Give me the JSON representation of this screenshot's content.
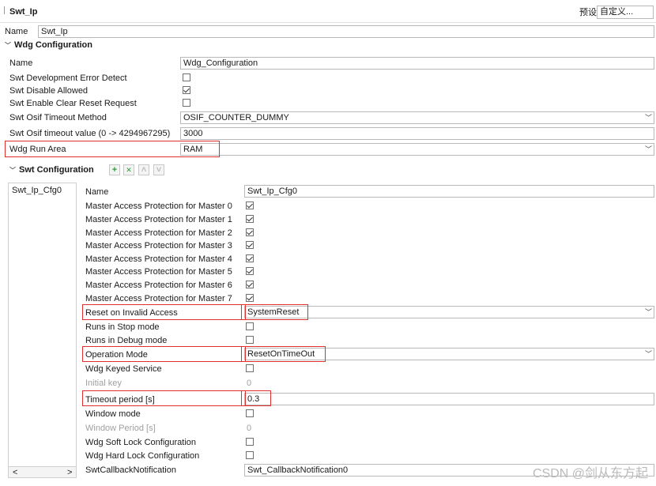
{
  "header": {
    "title": "Swt_Ip",
    "preset_label": "预设",
    "preset_value": "自定义..."
  },
  "top_name": {
    "label": "Name",
    "value": "Swt_Ip"
  },
  "wdg_config": {
    "title": "Wdg Configuration",
    "name_label": "Name",
    "name_value": "Wdg_Configuration",
    "dev_error_label": "Swt Development Error Detect",
    "disable_allowed_label": "Swt Disable Allowed",
    "clear_reset_label": "Swt Enable Clear Reset Request",
    "osif_method_label": "Swt Osif Timeout Method",
    "osif_method_value": "OSIF_COUNTER_DUMMY",
    "osif_timeout_label": "Swt Osif timeout value (0 -> 4294967295)",
    "osif_timeout_value": "3000",
    "run_area_label": "Wdg Run Area",
    "run_area_value": "RAM"
  },
  "swt_config": {
    "title": "Swt Configuration",
    "toolbar": {
      "add": "+",
      "remove": "✕",
      "up": "˄",
      "down": "˅"
    },
    "list_items": [
      "Swt_Ip_Cfg0"
    ],
    "name_label": "Name",
    "name_value": "Swt_Ip_Cfg0",
    "masters": [
      "Master Access Protection for Master 0",
      "Master Access Protection for Master 1",
      "Master Access Protection for Master 2",
      "Master Access Protection for Master 3",
      "Master Access Protection for Master 4",
      "Master Access Protection for Master 5",
      "Master Access Protection for Master 6",
      "Master Access Protection for Master 7"
    ],
    "reset_label": "Reset on Invalid Access",
    "reset_value": "SystemReset",
    "stop_label": "Runs in Stop mode",
    "debug_label": "Runs in Debug mode",
    "opmode_label": "Operation Mode",
    "opmode_value": "ResetOnTimeOut",
    "keyed_label": "Wdg Keyed Service",
    "initial_key_label": "Initial key",
    "initial_key_value": "0",
    "timeout_label": "Timeout period [s]",
    "timeout_value": "0.3",
    "window_label": "Window mode",
    "window_period_label": "Window Period [s]",
    "window_period_value": "0",
    "soft_lock_label": "Wdg Soft Lock Configuration",
    "hard_lock_label": "Wdg Hard Lock Configuration",
    "callback_label": "SwtCallbackNotification",
    "callback_value": "Swt_CallbackNotification0"
  },
  "scroll": {
    "left": "<",
    "right": ">"
  },
  "watermark": "CSDN @剑从东方起",
  "colors": {
    "highlight": "#e0302e",
    "add_icon": "#2e9e3a",
    "remove_icon": "#2e9e3a"
  }
}
